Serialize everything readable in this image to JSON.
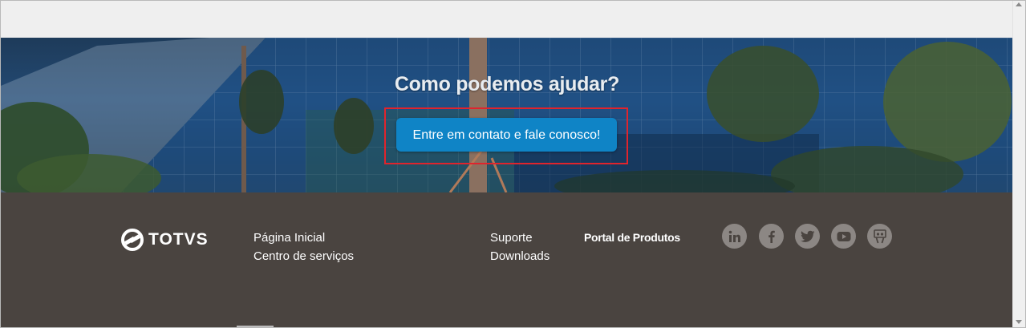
{
  "hero": {
    "title": "Como podemos ajudar?",
    "cta_label": "Entre em contato e fale conosco!"
  },
  "footer": {
    "brand": "TOTVS",
    "links_col1": [
      "Página Inicial",
      "Centro de serviços"
    ],
    "links_col2": [
      "Suporte",
      "Downloads"
    ],
    "portal_label": "Portal de Produtos",
    "social": [
      "linkedin-icon",
      "facebook-icon",
      "twitter-icon",
      "youtube-icon",
      "slideshare-icon"
    ]
  },
  "colors": {
    "cta": "#0f84c6",
    "highlight": "#e0242c",
    "footer_bg": "#4a4440",
    "social_bg": "#8c8784"
  }
}
